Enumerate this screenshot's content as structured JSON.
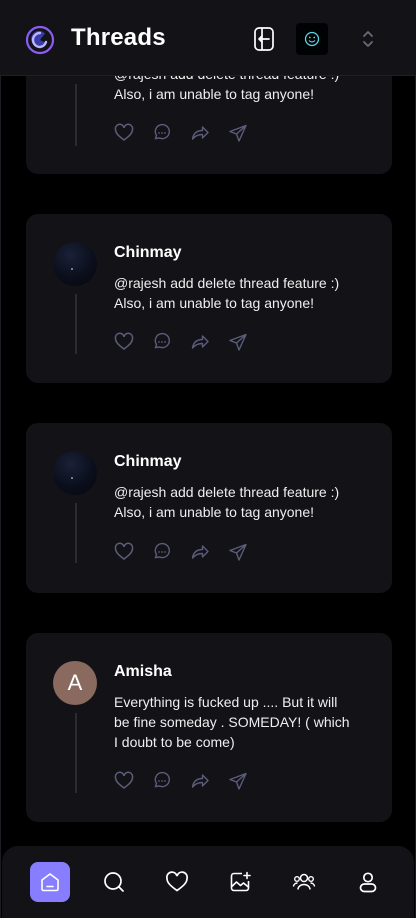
{
  "header": {
    "title": "Threads",
    "icons": [
      "logo-icon",
      "logout-icon",
      "user-avatar",
      "chevron-up-down-icon"
    ]
  },
  "threads": [
    {
      "author": "",
      "line1": "@rajesh add delete thread feature :)",
      "line2": "Also, i am unable to tag anyone!",
      "line3": ""
    },
    {
      "author": "Chinmay",
      "line1": "@rajesh add delete thread feature :)",
      "line2": "Also, i am unable to tag anyone!",
      "line3": ""
    },
    {
      "author": "Chinmay",
      "line1": "@rajesh add delete thread feature :)",
      "line2": "Also, i am unable to tag anyone!",
      "line3": ""
    },
    {
      "author": "Amisha",
      "avatar_letter": "A",
      "line1": "Everything is fucked up .... But it will",
      "line2": "be fine someday . SOMEDAY! ( which",
      "line3": "I doubt to be come)"
    }
  ],
  "actions": [
    "heart-icon",
    "reply-icon",
    "repost-icon",
    "share-icon"
  ],
  "bottom_nav": [
    "home",
    "search",
    "activity",
    "create-thread",
    "communities",
    "profile"
  ],
  "colors": {
    "accent": "#877eff",
    "card": "#121217",
    "background": "#000000"
  }
}
